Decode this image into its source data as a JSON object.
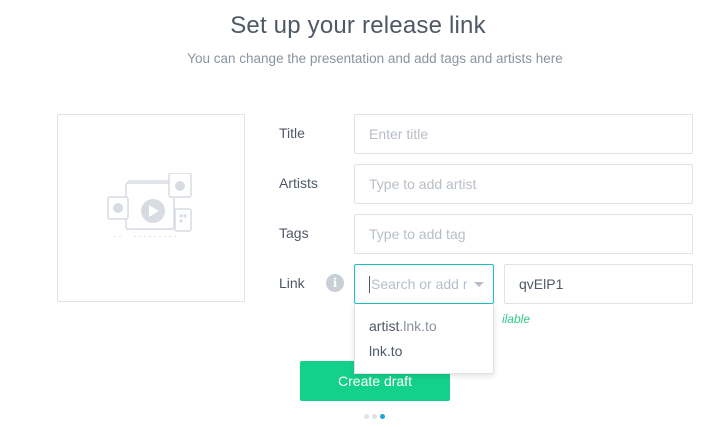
{
  "header": {
    "title": "Set up your release link",
    "subtitle": "You can change the presentation and add tags and artists here"
  },
  "artwork": {
    "icon": "media-devices-icon"
  },
  "form": {
    "title_label": "Title",
    "title_placeholder": "Enter title",
    "artists_label": "Artists",
    "artists_placeholder": "Type to add artist",
    "tags_label": "Tags",
    "tags_placeholder": "Type to add tag",
    "link_label": "Link",
    "link_info_icon": "i",
    "domain_placeholder": "Search or add r",
    "slug_value": "qvElP1",
    "availability_text": "ilable"
  },
  "dropdown": {
    "options": [
      {
        "main": "artist",
        "suffix": ".lnk.to"
      },
      {
        "main": "lnk.to",
        "suffix": ""
      }
    ]
  },
  "actions": {
    "create_label": "Create draft"
  },
  "pager": {
    "total": 3,
    "current": 3
  },
  "colors": {
    "accent": "#14d18a",
    "focus": "#17c3c8",
    "pager_active": "#1fa3e0",
    "available": "#2dcb8a"
  }
}
